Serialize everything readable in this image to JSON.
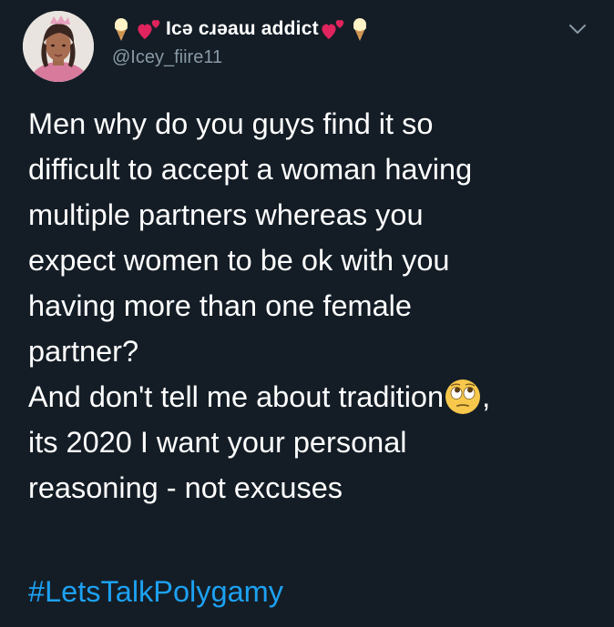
{
  "user": {
    "display_name_text": "Icə cɹəaɯ addict",
    "handle": "@Icey_fiire11",
    "left_icons": [
      "ice-cream-icon",
      "hearts-icon"
    ],
    "right_icons": [
      "hearts-icon",
      "ice-cream-icon"
    ]
  },
  "tweet": {
    "lines": [
      "Men why do you guys find it so",
      "difficult to accept a woman having",
      "multiple partners whereas you",
      "expect women to be ok with you",
      "having more than one female",
      "partner?",
      "And don't tell me about tradition",
      "its 2020 I want your personal",
      "reasoning - not excuses"
    ],
    "after_emoji": ",",
    "inline_emoji": "eye-roll-emoji-icon",
    "hashtag": "#LetsTalkPolygamy"
  },
  "colors": {
    "background": "#141d26",
    "text": "#ffffff",
    "secondary": "#8899a6",
    "link": "#1da1f2",
    "heart": "#e0245e"
  }
}
